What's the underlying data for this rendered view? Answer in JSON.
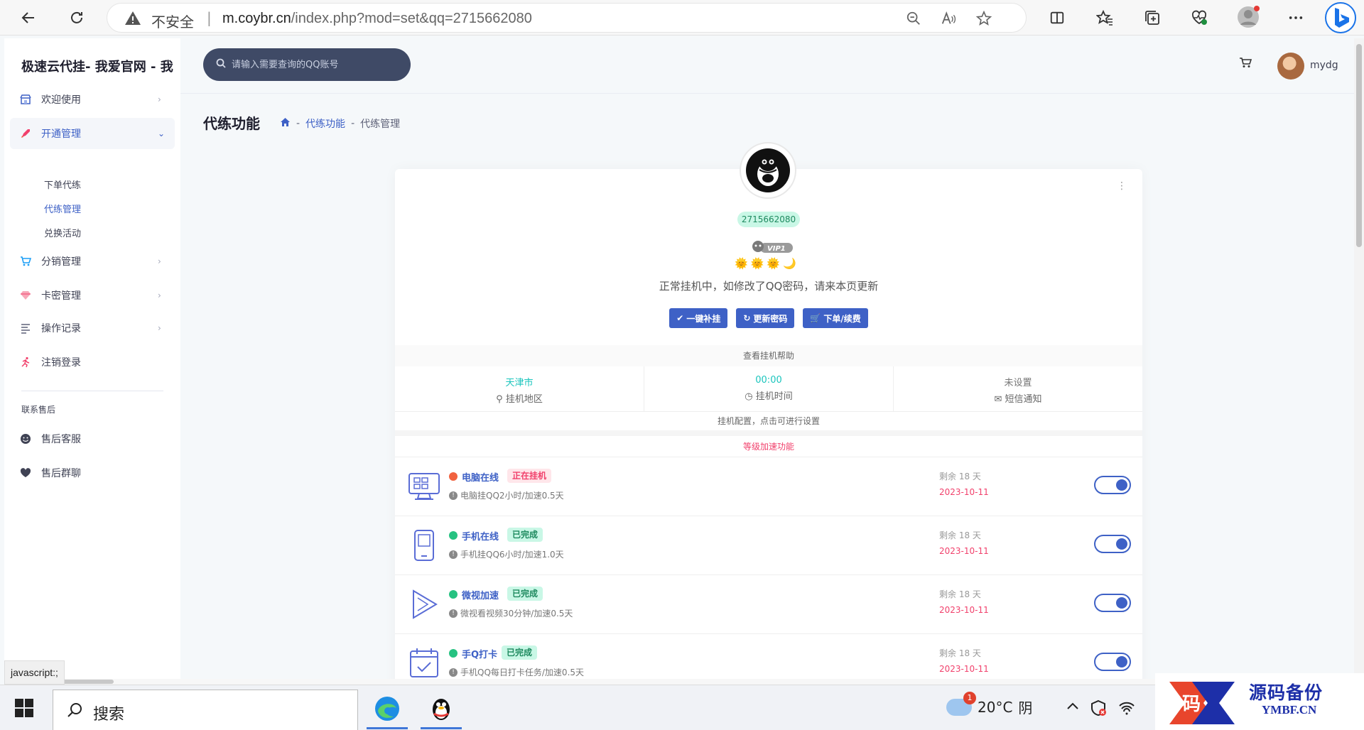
{
  "browser": {
    "security_label": "不安全",
    "url_host": "m.coybr.cn",
    "url_path": "/index.php?mod=set&qq=2715662080",
    "status_text": "javascript:;"
  },
  "sidebar": {
    "brand": "极速云代挂- 我爱官网 - 我",
    "items": [
      {
        "label": "欢迎使用",
        "icon": "shop-icon"
      },
      {
        "label": "开通管理",
        "icon": "rocket-icon"
      },
      {
        "label": "分销管理",
        "icon": "cart-icon"
      },
      {
        "label": "卡密管理",
        "icon": "diamond-icon"
      },
      {
        "label": "操作记录",
        "icon": "list-icon"
      },
      {
        "label": "注销登录",
        "icon": "run-icon"
      }
    ],
    "sub_items": [
      "下单代练",
      "代练管理",
      "兑换活动"
    ],
    "section_label": "联系售后",
    "contact_items": [
      {
        "label": "售后客服",
        "icon": "smile-icon"
      },
      {
        "label": "售后群聊",
        "icon": "heart-icon"
      }
    ]
  },
  "topbar": {
    "search_placeholder": "请输入需要查询的QQ账号",
    "username": "mydg"
  },
  "page": {
    "title": "代练功能",
    "breadcrumb": [
      "代练功能",
      "代练管理"
    ]
  },
  "profile": {
    "qq": "2715662080",
    "vip": "VIP1",
    "level_icons": "🌞🌞🌞🌙",
    "status_message": "正常挂机中，如修改了QQ密码，请来本页更新",
    "buttons": [
      "一键补挂",
      "更新密码",
      "下单/续费"
    ],
    "help_link": "查看挂机帮助"
  },
  "stats": [
    {
      "value": "天津市",
      "label": "挂机地区",
      "icon": "pin-icon",
      "color": "#1bc5bd"
    },
    {
      "value": "00:00",
      "label": "挂机时间",
      "icon": "clock-icon",
      "color": "#1bc5bd"
    },
    {
      "value": "未设置",
      "label": "短信通知",
      "icon": "mail-icon",
      "color": "#777777"
    }
  ],
  "config_hint": "挂机配置，点击可进行设置",
  "features_title": "等级加速功能",
  "features": [
    {
      "name": "电脑在线",
      "tag": "正在挂机",
      "tag_type": "orange",
      "dot": "#f1623f",
      "desc": "电脑挂QQ2小时/加速0.5天",
      "remain": "剩余 18 天",
      "date": "2023-10-11",
      "icon": "desktop-icon"
    },
    {
      "name": "手机在线",
      "tag": "已完成",
      "tag_type": "green",
      "dot": "#26c281",
      "desc": "手机挂QQ6小时/加速1.0天",
      "remain": "剩余 18 天",
      "date": "2023-10-11",
      "icon": "phone-icon"
    },
    {
      "name": "微视加速",
      "tag": "已完成",
      "tag_type": "green",
      "dot": "#26c281",
      "desc": "微视看视频30分钟/加速0.5天",
      "remain": "剩余 18 天",
      "date": "2023-10-11",
      "icon": "play-icon"
    },
    {
      "name": "手Q打卡",
      "tag": "已完成",
      "tag_type": "green",
      "dot": "#26c281",
      "desc": "手机QQ每日打卡任务/加速0.5天",
      "remain": "剩余 18 天",
      "date": "2023-10-11",
      "icon": "calendar-check-icon"
    }
  ],
  "taskbar": {
    "search_text": "搜索",
    "temperature": "20°C",
    "weather": "阴",
    "weather_badge": "1"
  },
  "watermark": {
    "title": "源码备份",
    "url": "YMBF.CN"
  },
  "colors": {
    "accent": "#3e61c6",
    "danger": "#f1416c",
    "success": "#26c281"
  }
}
